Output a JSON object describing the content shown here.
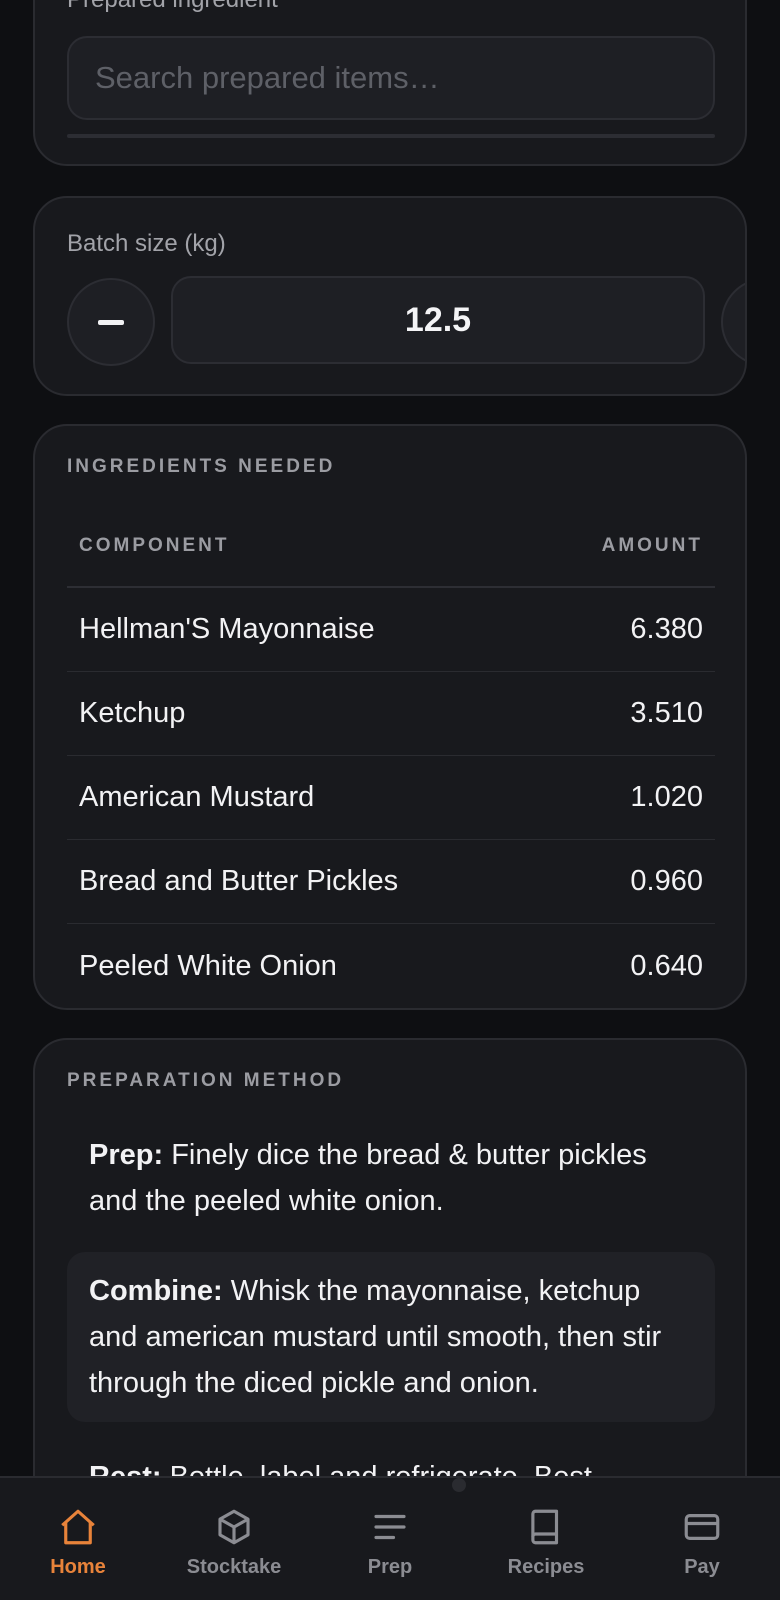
{
  "prepared": {
    "label": "Prepared ingredient",
    "search_placeholder": "Search prepared items…"
  },
  "batch": {
    "label": "Batch size (kg)",
    "value": "12.5"
  },
  "ingredients": {
    "title": "INGREDIENTS NEEDED",
    "columns": {
      "component": "COMPONENT",
      "amount": "AMOUNT"
    },
    "rows": [
      {
        "component": "Hellman'S Mayonnaise",
        "amount": "6.380"
      },
      {
        "component": "Ketchup",
        "amount": "3.510"
      },
      {
        "component": "American Mustard",
        "amount": "1.020"
      },
      {
        "component": "Bread and Butter Pickles",
        "amount": "0.960"
      },
      {
        "component": "Peeled White Onion",
        "amount": "0.640"
      }
    ]
  },
  "method": {
    "title": "PREPARATION METHOD",
    "steps": [
      {
        "label": "Prep:",
        "text": "Finely dice the bread & butter pickles and the peeled white onion."
      },
      {
        "label": "Combine:",
        "text": "Whisk the mayonnaise, ketchup and american mustard until smooth, then stir through the diced pickle and onion."
      },
      {
        "label": "Rest:",
        "text": "Bottle, label and refrigerate. Best"
      }
    ]
  },
  "nav": {
    "items": [
      {
        "label": "Home",
        "icon": "home-icon",
        "active": true
      },
      {
        "label": "Stocktake",
        "icon": "box-icon",
        "active": false
      },
      {
        "label": "Prep",
        "icon": "list-icon",
        "active": false
      },
      {
        "label": "Recipes",
        "icon": "book-icon",
        "active": false
      },
      {
        "label": "Pay",
        "icon": "card-icon",
        "active": false
      }
    ]
  },
  "colors": {
    "accent": "#e8833a",
    "background": "#0e0f12",
    "card": "#18191d",
    "muted_text": "#9b9ca2"
  }
}
